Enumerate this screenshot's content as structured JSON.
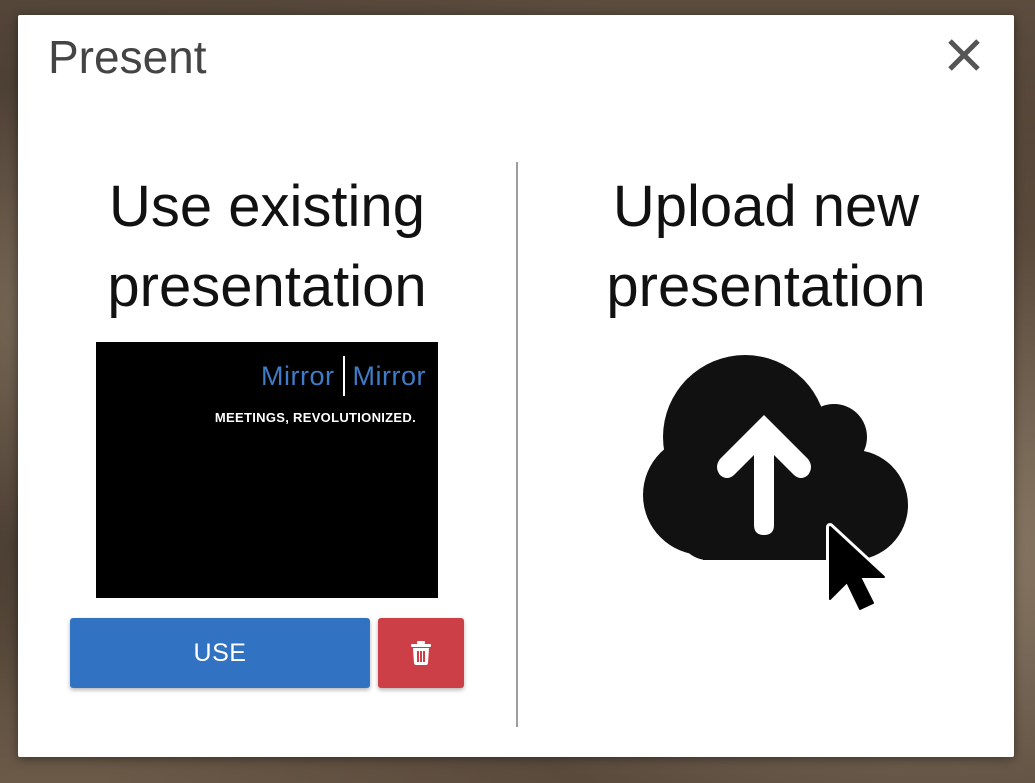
{
  "dialog": {
    "title": "Present",
    "close_icon": "close-icon"
  },
  "existing": {
    "heading_line1": "Use existing",
    "heading_line2": "presentation",
    "thumbnail": {
      "logo_left": "Mirror",
      "logo_right": "Mirror",
      "tagline": "MEETINGS, REVOLUTIONIZED."
    },
    "use_label": "USE",
    "delete_icon": "trash-icon"
  },
  "upload": {
    "heading_line1": "Upload new",
    "heading_line2": "presentation",
    "icon": "cloud-upload-icon"
  },
  "colors": {
    "primary": "#3272c2",
    "danger": "#cd3f47",
    "logo_blue": "#3f7bc6"
  }
}
